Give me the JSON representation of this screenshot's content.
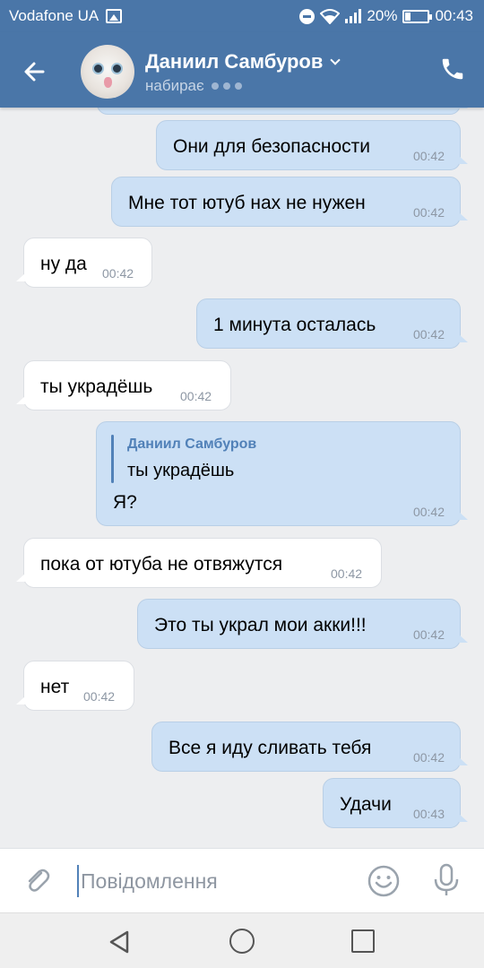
{
  "status_bar": {
    "carrier": "Vodafone UA",
    "battery": "20%",
    "battery_level": 0.2,
    "time": "00:43",
    "icons": [
      "image-icon",
      "do-not-disturb-icon",
      "wifi-icon",
      "signal-icon",
      "battery-icon"
    ]
  },
  "header": {
    "contact_name": "Даниил Самбуров",
    "status": "набирає",
    "icons": [
      "back-arrow-icon",
      "chevron-down-icon",
      "phone-icon"
    ],
    "accent_color": "#4a76a8"
  },
  "messages": [
    {
      "dir": "out",
      "text": "Они для безопасности",
      "time": "00:42"
    },
    {
      "dir": "out",
      "text": "Мне тот ютуб нах не нужен",
      "time": "00:42"
    },
    {
      "dir": "in",
      "text": "ну да",
      "time": "00:42"
    },
    {
      "dir": "out",
      "text": "1 минута осталась",
      "time": "00:42"
    },
    {
      "dir": "in",
      "text": "ты украдёшь",
      "time": "00:42"
    },
    {
      "dir": "out",
      "reply_author": "Даниил Самбуров",
      "reply_text": "ты украдёшь",
      "text": "Я?",
      "time": "00:42"
    },
    {
      "dir": "in",
      "text": "пока от ютуба не отвяжутся",
      "time": "00:42"
    },
    {
      "dir": "out",
      "text": "Это ты украл мои акки!!!",
      "time": "00:42"
    },
    {
      "dir": "in",
      "text": "нет",
      "time": "00:42"
    },
    {
      "dir": "out",
      "text": "Все я иду сливать тебя",
      "time": "00:42"
    },
    {
      "dir": "out",
      "text": "Удачи",
      "time": "00:43"
    }
  ],
  "composer": {
    "placeholder": "Повідомлення",
    "value": "",
    "icons": [
      "paperclip-icon",
      "emoji-icon",
      "microphone-icon"
    ]
  },
  "nav_bar": {
    "icons": [
      "nav-back-icon",
      "nav-home-icon",
      "nav-recent-icon"
    ]
  },
  "colors": {
    "outgoing_bubble": "#cce0f5",
    "incoming_bubble": "#ffffff",
    "chat_background": "#edeef0"
  }
}
